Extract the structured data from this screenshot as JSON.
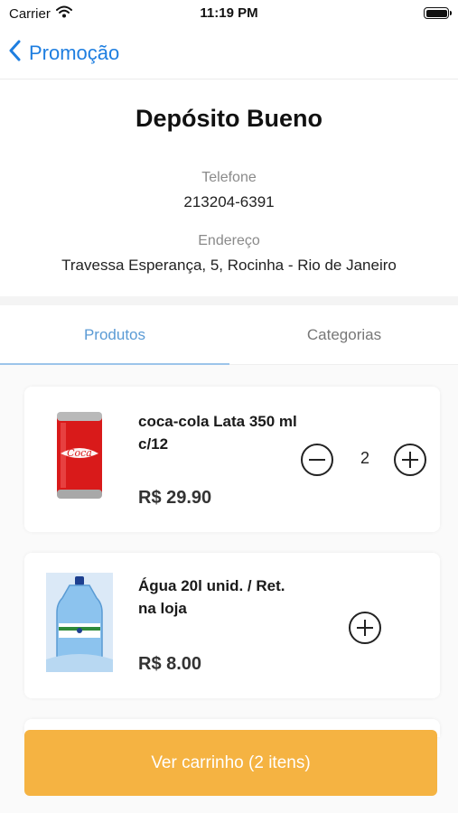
{
  "status_bar": {
    "carrier": "Carrier",
    "time": "11:19 PM"
  },
  "nav": {
    "back_label": "Promoção"
  },
  "store": {
    "name": "Depósito Bueno",
    "phone_label": "Telefone",
    "phone": "213204-6391",
    "address_label": "Endereço",
    "address": "Travessa Esperança, 5, Rocinha - Rio de Janeiro"
  },
  "tabs": [
    {
      "label": "Produtos",
      "active": true
    },
    {
      "label": "Categorias",
      "active": false
    }
  ],
  "products": [
    {
      "name": "coca-cola  Lata 350 ml c/12",
      "price": "R$ 29.90",
      "quantity": "2",
      "image": "coca-cola-can"
    },
    {
      "name": "Água  20l  unid. / Ret. na loja",
      "price": "R$ 8.00",
      "image": "water-jug"
    }
  ],
  "cart_button": {
    "label": "Ver carrinho (2 itens)"
  },
  "colors": {
    "accent": "#1e7ee0",
    "cart": "#f5b342",
    "tab_active": "#5b9bd5"
  }
}
